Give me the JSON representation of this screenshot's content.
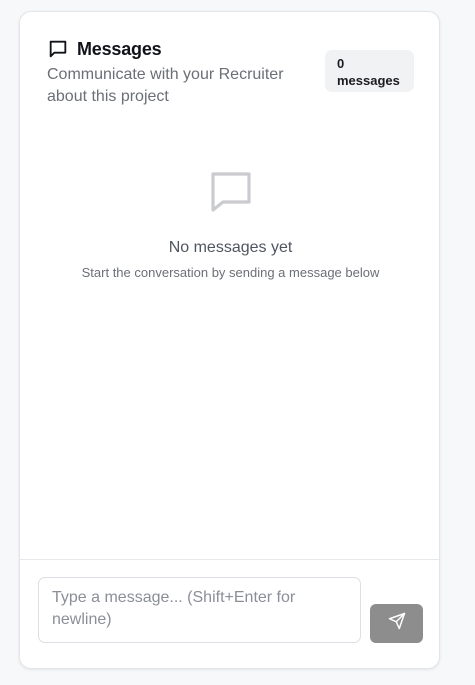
{
  "header": {
    "title": "Messages",
    "title_icon": "message-square-icon",
    "subtitle": "Communicate with your Recruiter about this project",
    "badge_count": "0",
    "badge_unit": "messages"
  },
  "empty_state": {
    "icon": "message-square-icon",
    "title": "No messages yet",
    "subtitle": "Start the conversation by sending a message below"
  },
  "composer": {
    "placeholder": "Type a message... (Shift+Enter for newline)",
    "send_icon": "send-icon"
  },
  "colors": {
    "send_button": "#8d8d8d",
    "badge_bg": "#f1f2f4",
    "muted_text": "#6b6f76"
  }
}
